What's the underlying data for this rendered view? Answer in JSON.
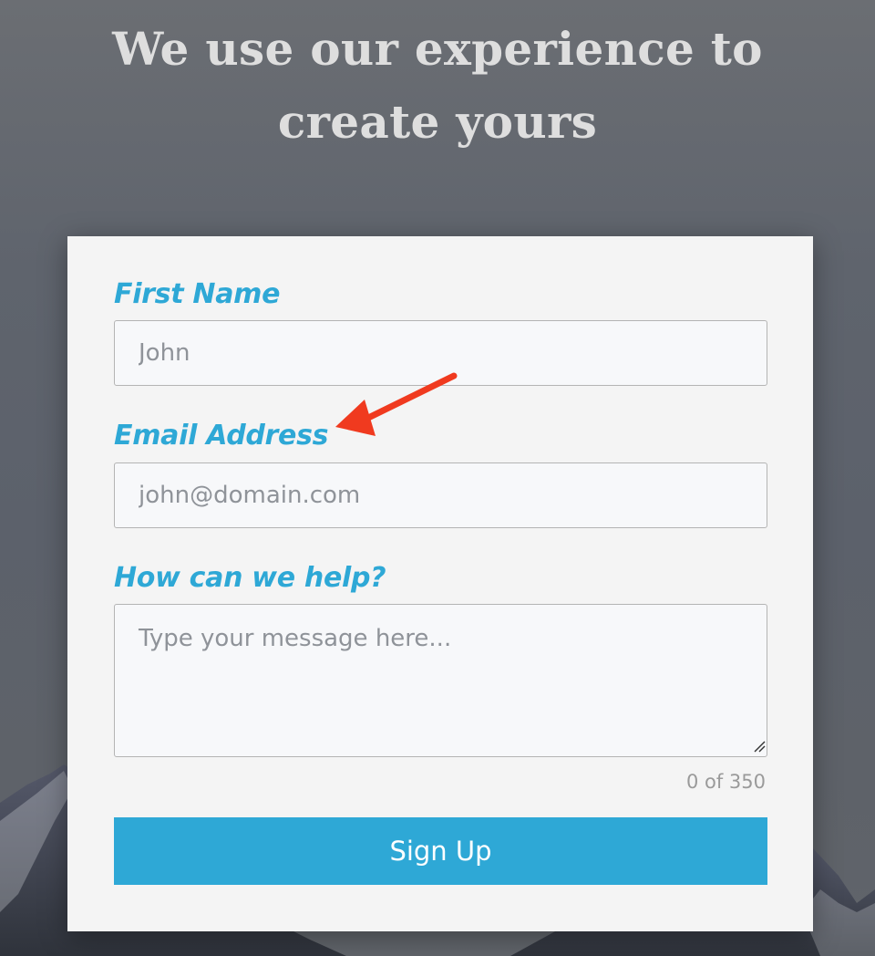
{
  "hero": {
    "line1": "We use our experience to",
    "line2": "create yours"
  },
  "form": {
    "first_name": {
      "label": "First Name",
      "placeholder": "John",
      "value": ""
    },
    "email": {
      "label": "Email Address",
      "placeholder": "john@domain.com",
      "value": ""
    },
    "message": {
      "label": "How can we help?",
      "placeholder": "Type your message here...",
      "value": ""
    },
    "counter": "0 of 350",
    "submit_label": "Sign Up"
  },
  "annotation": {
    "icon": "arrow-icon",
    "color": "#f03a1f"
  },
  "colors": {
    "accent": "#2ea8d6",
    "card": "#f4f4f4",
    "field_bg": "#f7f8fa"
  }
}
